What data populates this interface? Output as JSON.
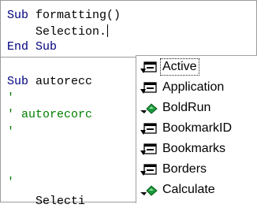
{
  "editor": {
    "lines": [
      {
        "kw": "Sub",
        "rest": " formatting()"
      },
      {
        "text": "    Selection."
      },
      {
        "kw1": "End",
        "mid": " ",
        "kw2": "Sub"
      },
      {
        "kw": "Sub",
        "rest": " autorecc"
      },
      {
        "comment": "'"
      },
      {
        "comment": "' autorecorc"
      },
      {
        "comment": "'"
      },
      {
        "comment": "'"
      },
      {
        "text": "    Selecti"
      }
    ]
  },
  "autocomplete": {
    "selected_index": 0,
    "items": [
      {
        "label": "Active",
        "icon": "property-icon"
      },
      {
        "label": "Application",
        "icon": "property-icon"
      },
      {
        "label": "BoldRun",
        "icon": "method-icon"
      },
      {
        "label": "BookmarkID",
        "icon": "property-icon"
      },
      {
        "label": "Bookmarks",
        "icon": "property-icon"
      },
      {
        "label": "Borders",
        "icon": "property-icon"
      },
      {
        "label": "Calculate",
        "icon": "method-icon"
      }
    ]
  },
  "colors": {
    "keyword": "#00007f",
    "comment": "#007f00",
    "method_icon": "#1a9a3a"
  }
}
